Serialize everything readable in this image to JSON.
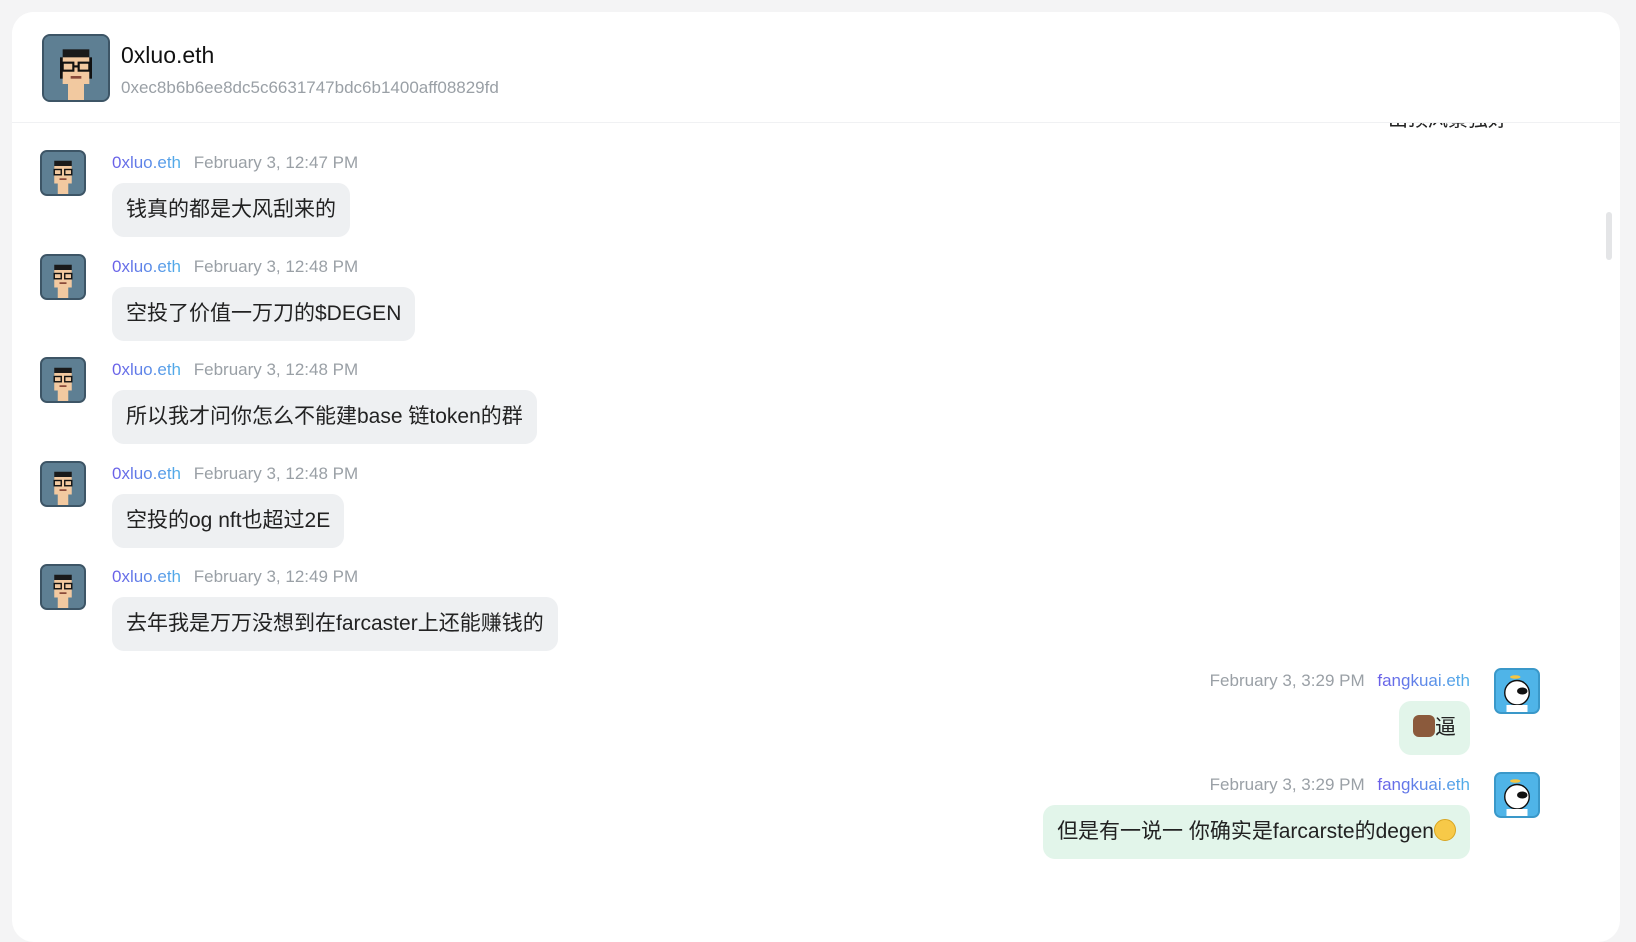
{
  "chat": {
    "name": "0xluo.eth",
    "address": "0xec8b6b6ee8dc5c6631747bdc6b1400aff08829fd"
  },
  "cut_off_text": "出顶风景独好",
  "messages": [
    {
      "sender": "0xluo.eth",
      "time": "February 3, 12:47 PM",
      "text": "钱真的都是大风刮来的"
    },
    {
      "sender": "0xluo.eth",
      "time": "February 3, 12:48 PM",
      "text": "空投了价值一万刀的$DEGEN"
    },
    {
      "sender": "0xluo.eth",
      "time": "February 3, 12:48 PM",
      "text": "所以我才问你怎么不能建base 链token的群"
    },
    {
      "sender": "0xluo.eth",
      "time": "February 3, 12:48 PM",
      "text": "空投的og nft也超过2E"
    },
    {
      "sender": "0xluo.eth",
      "time": "February 3, 12:49 PM",
      "text": "去年我是万万没想到在farcaster上还能赚钱的"
    },
    {
      "sender": "fangkuai.eth",
      "time": "February 3, 3:29 PM",
      "text": "逼",
      "prefix_icon": "cow-face-emoji"
    },
    {
      "sender": "fangkuai.eth",
      "time": "February 3, 3:29 PM",
      "text": "但是有一说一 你确实是farcarste的degen",
      "suffix_icon": "tears-of-joy-emoji"
    }
  ],
  "colors": {
    "incoming_bubble": "#eef0f2",
    "outgoing_bubble": "#e2f5ea",
    "sender_gradient_start": "#6b5ee8",
    "sender_gradient_end": "#4fb0e8",
    "meta_gray": "#9aa0a6"
  }
}
